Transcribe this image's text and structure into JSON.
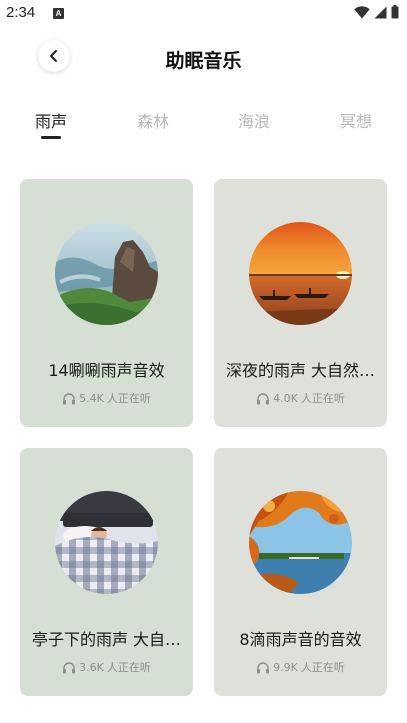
{
  "status_bar": {
    "time": "2:34",
    "notification_letter": "A"
  },
  "header": {
    "title": "助眠音乐"
  },
  "tabs": [
    {
      "label": "雨声",
      "active": true
    },
    {
      "label": "森林",
      "active": false
    },
    {
      "label": "海浪",
      "active": false
    },
    {
      "label": "冥想",
      "active": false
    }
  ],
  "cards": [
    {
      "title": "14唰唰雨声音效",
      "count": "5.4K",
      "suffix": "人正在听",
      "bg": "#d5dfd3",
      "image": "misty-mountain"
    },
    {
      "title": "深夜的雨声 大自然…",
      "count": "4.0K",
      "suffix": "人正在听",
      "bg": "#dde1da",
      "image": "sunset-lake-boats"
    },
    {
      "title": "亭子下的雨声 大自…",
      "count": "3.6K",
      "suffix": "人正在听",
      "bg": "#d5dfd3",
      "image": "sleeping-person"
    },
    {
      "title": "8滴雨声音的音效",
      "count": "9.9K",
      "suffix": "人正在听",
      "bg": "#dde1da",
      "image": "autumn-lake"
    }
  ],
  "colors": {
    "card_green": "#d5dfd3",
    "card_grey": "#dde1da",
    "active_tab": "#222222",
    "inactive_tab": "#b8b8b8"
  }
}
